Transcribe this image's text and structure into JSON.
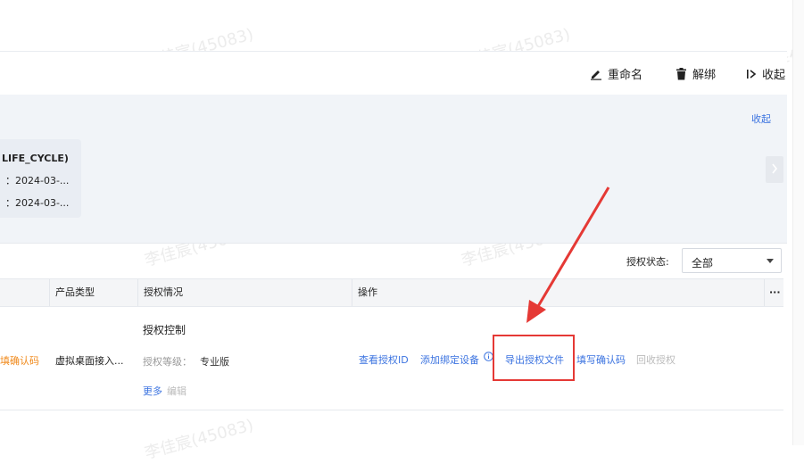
{
  "toolbar": {
    "rename_label": "重命名",
    "unbind_label": "解绑",
    "collapse_label": "收起"
  },
  "summary": {
    "collapse_link": "收起",
    "card_title": "LIFE_CYCLE)",
    "card_line1": "：2024-03-...",
    "card_line2": "：2024-03-..."
  },
  "filter": {
    "label": "授权状态:",
    "value": "全部"
  },
  "table": {
    "headers": {
      "product_type": "产品类型",
      "auth_status": "授权情况",
      "actions": "操作",
      "more": "···"
    },
    "row": {
      "left_link": "填确认码",
      "product_type": "虚拟桌面接入...",
      "auth_title": "授权控制",
      "auth_level_label": "授权等级：",
      "auth_level_value": "专业版",
      "more_link": "更多",
      "edit_link": "编辑",
      "actions": {
        "view_id": "查看授权ID",
        "add_device": "添加绑定设备",
        "export_file": "导出授权文件",
        "fill_code": "填写确认码",
        "revoke": "回收授权"
      }
    }
  },
  "watermark": "李佳宸(45083)",
  "colors": {
    "link": "#3b73e0",
    "warning": "#f08a1c",
    "highlight": "#e53935"
  }
}
